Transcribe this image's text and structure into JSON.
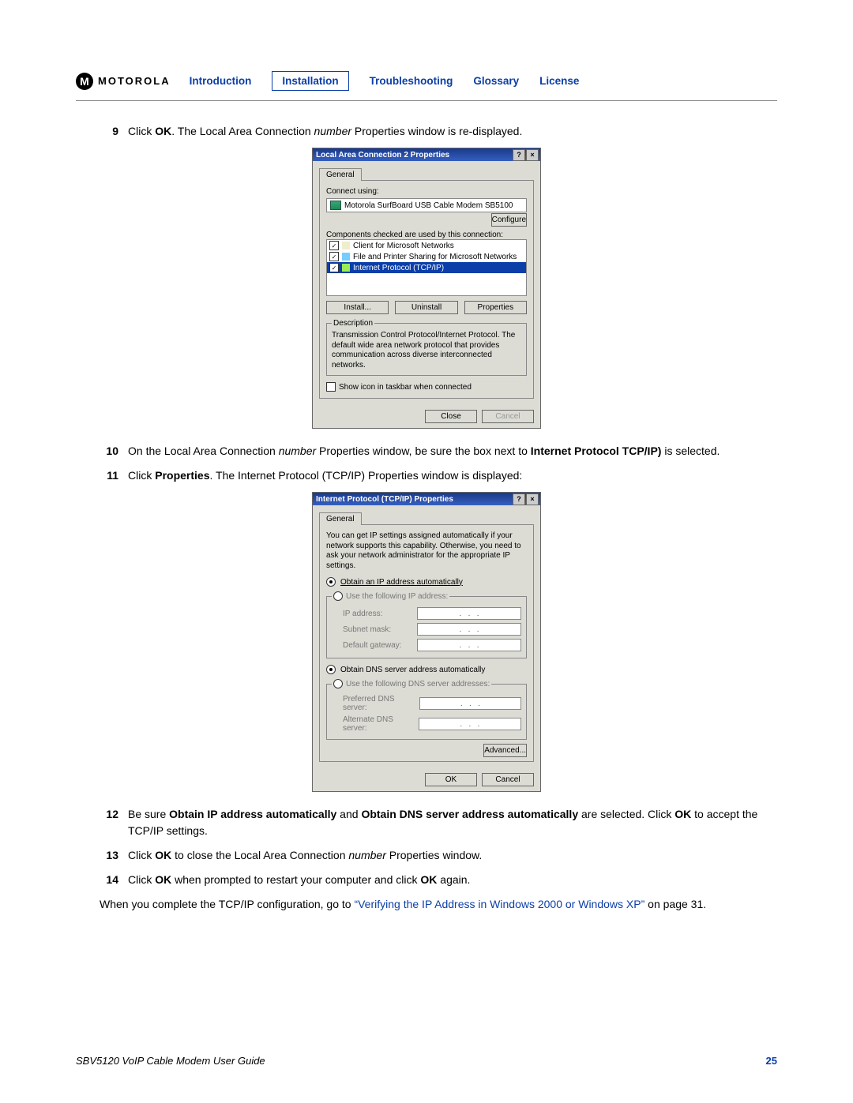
{
  "header": {
    "brand": "MOTOROLA",
    "nav": [
      "Introduction",
      "Installation",
      "Troubleshooting",
      "Glossary",
      "License"
    ]
  },
  "steps": {
    "s9": {
      "num": "9",
      "pre": "Click ",
      "b1": "OK",
      "post": ". The Local Area Connection ",
      "it": "number",
      "tail": " Properties window is re-displayed."
    },
    "s10": {
      "num": "10",
      "pre": "On the Local Area Connection ",
      "it": "number",
      "post": " Properties window, be sure the box next to ",
      "b1": "Internet Protocol TCP/IP)",
      "tail": " is selected."
    },
    "s11": {
      "num": "11",
      "pre": "Click ",
      "b1": "Properties",
      "post": ". The Internet Protocol (TCP/IP) Properties window is displayed:"
    },
    "s12": {
      "num": "12",
      "pre": "Be sure ",
      "b1": "Obtain IP address automatically",
      "mid": " and ",
      "b2": "Obtain DNS server address automatically",
      "post": " are selected. Click ",
      "b3": "OK",
      "tail": " to accept the TCP/IP settings."
    },
    "s13": {
      "num": "13",
      "pre": "Click ",
      "b1": "OK",
      "post": " to close the Local Area Connection ",
      "it": "number",
      "tail": " Properties window."
    },
    "s14": {
      "num": "14",
      "pre": "Click ",
      "b1": "OK",
      "post": " when prompted to restart your computer and click ",
      "b2": "OK",
      "tail": " again."
    }
  },
  "closing": {
    "pre": "When you complete the TCP/IP configuration, go to ",
    "link": "“Verifying the IP Address in Windows 2000 or Windows XP”",
    "post": " on page 31."
  },
  "dialog1": {
    "title": "Local Area Connection 2 Properties",
    "tab": "General",
    "connect_label": "Connect using:",
    "adapter": "Motorola SurfBoard USB Cable Modem SB5100",
    "configure": "Configure",
    "components_label": "Components checked are used by this connection:",
    "items": [
      "Client for Microsoft Networks",
      "File and Printer Sharing for Microsoft Networks",
      "Internet Protocol (TCP/IP)"
    ],
    "install": "Install...",
    "uninstall": "Uninstall",
    "properties": "Properties",
    "desc_title": "Description",
    "desc_text": "Transmission Control Protocol/Internet Protocol. The default wide area network protocol that provides communication across diverse interconnected networks.",
    "show_icon": "Show icon in taskbar when connected",
    "close": "Close",
    "cancel": "Cancel"
  },
  "dialog2": {
    "title": "Internet Protocol (TCP/IP) Properties",
    "tab": "General",
    "intro": "You can get IP settings assigned automatically if your network supports this capability. Otherwise, you need to ask your network administrator for the appropriate IP settings.",
    "r1": "Obtain an IP address automatically",
    "r2": "Use the following IP address:",
    "ip": "IP address:",
    "subnet": "Subnet mask:",
    "gateway": "Default gateway:",
    "r3": "Obtain DNS server address automatically",
    "r4": "Use the following DNS server addresses:",
    "pref": "Preferred DNS server:",
    "alt": "Alternate DNS server:",
    "advanced": "Advanced...",
    "ok": "OK",
    "cancel": "Cancel"
  },
  "footer": {
    "guide": "SBV5120 VoIP Cable Modem User Guide",
    "page": "25"
  }
}
